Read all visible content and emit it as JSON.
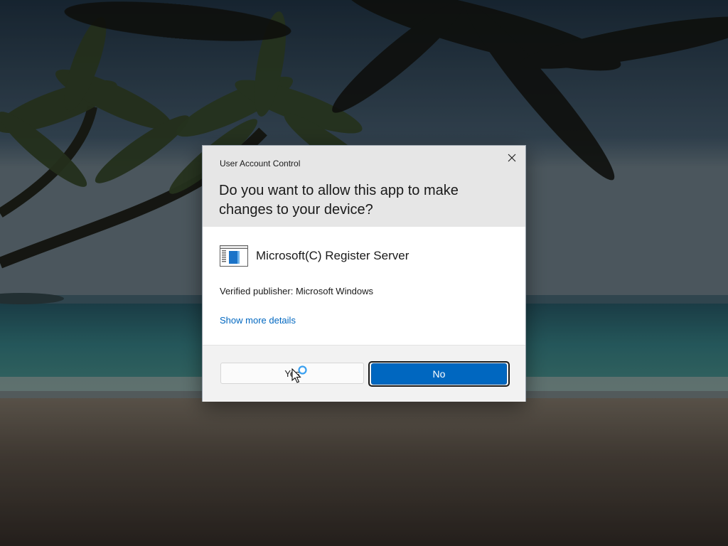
{
  "dialog": {
    "title": "User Account Control",
    "question": "Do you want to allow this app to make changes to your device?",
    "app_name": "Microsoft(C) Register Server",
    "publisher": "Verified publisher: Microsoft Windows",
    "details_link": "Show more details",
    "yes_label": "Yes",
    "no_label": "No"
  },
  "icons": {
    "close": "close-icon",
    "app": "app-window-icon",
    "cursor": "busy-arrow-cursor-icon"
  },
  "colors": {
    "accent": "#0067c0",
    "header_bg": "#e6e6e6",
    "footer_bg": "#f2f2f2",
    "link": "#0067c0"
  }
}
